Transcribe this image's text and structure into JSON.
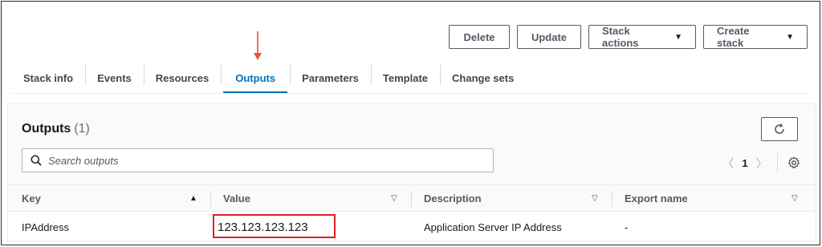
{
  "header_actions": {
    "delete": "Delete",
    "update": "Update",
    "stack_actions": "Stack actions",
    "create_stack": "Create stack"
  },
  "tabs": [
    {
      "label": "Stack info",
      "active": false
    },
    {
      "label": "Events",
      "active": false
    },
    {
      "label": "Resources",
      "active": false
    },
    {
      "label": "Outputs",
      "active": true
    },
    {
      "label": "Parameters",
      "active": false
    },
    {
      "label": "Template",
      "active": false
    },
    {
      "label": "Change sets",
      "active": false
    }
  ],
  "outputs_panel": {
    "title": "Outputs",
    "count": "(1)",
    "search_placeholder": "Search outputs",
    "pagination": {
      "current_page": "1"
    }
  },
  "table": {
    "columns": [
      "Key",
      "Value",
      "Description",
      "Export name"
    ],
    "rows": [
      {
        "key": "IPAddress",
        "value": "123.123.123.123",
        "description": "Application Server IP Address",
        "export_name": "-"
      }
    ]
  },
  "colors": {
    "accent": "#0073bb",
    "annotation_arrow": "#e8533a",
    "highlight_box": "#e02020"
  }
}
